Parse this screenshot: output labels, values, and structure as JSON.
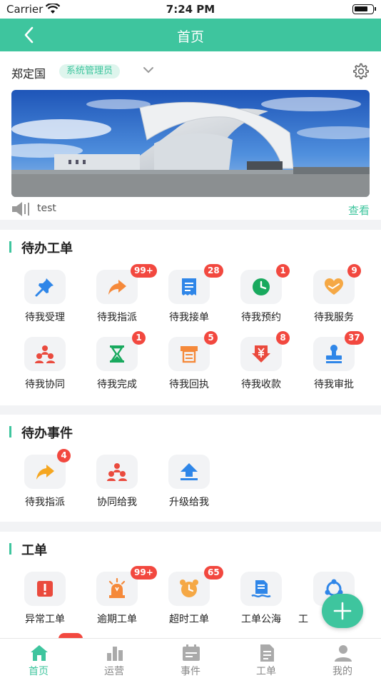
{
  "status_bar": {
    "carrier": "Carrier",
    "time": "7:24 PM"
  },
  "nav": {
    "title": "首页"
  },
  "profile": {
    "name": "郑定国",
    "role": "系统管理员"
  },
  "notice": {
    "text": "test",
    "view_label": "查看"
  },
  "sections": [
    {
      "title": "待办工单",
      "items": [
        {
          "label": "待我受理",
          "badge": "",
          "icon": "pin-icon",
          "color": "#2f86e8"
        },
        {
          "label": "待我指派",
          "badge": "99+",
          "icon": "share-arrow-icon",
          "color": "#f5893a"
        },
        {
          "label": "待我接单",
          "badge": "28",
          "icon": "receipt-icon",
          "color": "#2f86e8"
        },
        {
          "label": "待我预约",
          "badge": "1",
          "icon": "clock-icon",
          "color": "#19a95e"
        },
        {
          "label": "待我服务",
          "badge": "9",
          "icon": "heart-icon",
          "color": "#f5a845"
        },
        {
          "label": "待我协同",
          "badge": "",
          "icon": "team-icon",
          "color": "#ea4a3d"
        },
        {
          "label": "待我完成",
          "badge": "1",
          "icon": "hourglass-icon",
          "color": "#19a95e"
        },
        {
          "label": "待我回执",
          "badge": "5",
          "icon": "printer-icon",
          "color": "#f5893a"
        },
        {
          "label": "待我收款",
          "badge": "8",
          "icon": "yuan-down-icon",
          "color": "#ea4a3d"
        },
        {
          "label": "待我审批",
          "badge": "37",
          "icon": "stamp-icon",
          "color": "#2f86e8"
        }
      ]
    },
    {
      "title": "待办事件",
      "items": [
        {
          "label": "待我指派",
          "badge": "4",
          "icon": "share-arrow-icon",
          "color": "#f5a620"
        },
        {
          "label": "协同给我",
          "badge": "",
          "icon": "team-icon",
          "color": "#ea4a3d"
        },
        {
          "label": "升级给我",
          "badge": "",
          "icon": "upgrade-icon",
          "color": "#2f86e8"
        }
      ]
    },
    {
      "title": "工单",
      "items": [
        {
          "label": "异常工单",
          "badge": "",
          "icon": "alert-icon",
          "color": "#ea4a3d"
        },
        {
          "label": "逾期工单",
          "badge": "99+",
          "icon": "alarm-icon",
          "color": "#f5893a"
        },
        {
          "label": "超时工单",
          "badge": "65",
          "icon": "timeout-clock-icon",
          "color": "#f5a845"
        },
        {
          "label": "工单公海",
          "badge": "",
          "icon": "doc-sea-icon",
          "color": "#2f86e8"
        },
        {
          "label": "工",
          "badge": "",
          "icon": "cycle-icon",
          "color": "#2f86e8"
        }
      ]
    }
  ],
  "tabs": [
    {
      "label": "首页",
      "icon": "home-icon",
      "active": true
    },
    {
      "label": "运营",
      "icon": "bar-chart-icon",
      "active": false
    },
    {
      "label": "事件",
      "icon": "calendar-icon",
      "active": false
    },
    {
      "label": "工单",
      "icon": "document-icon",
      "active": false
    },
    {
      "label": "我的",
      "icon": "user-icon",
      "active": false
    }
  ],
  "colors": {
    "accent": "#3ec59e",
    "badge": "#f2483f"
  }
}
